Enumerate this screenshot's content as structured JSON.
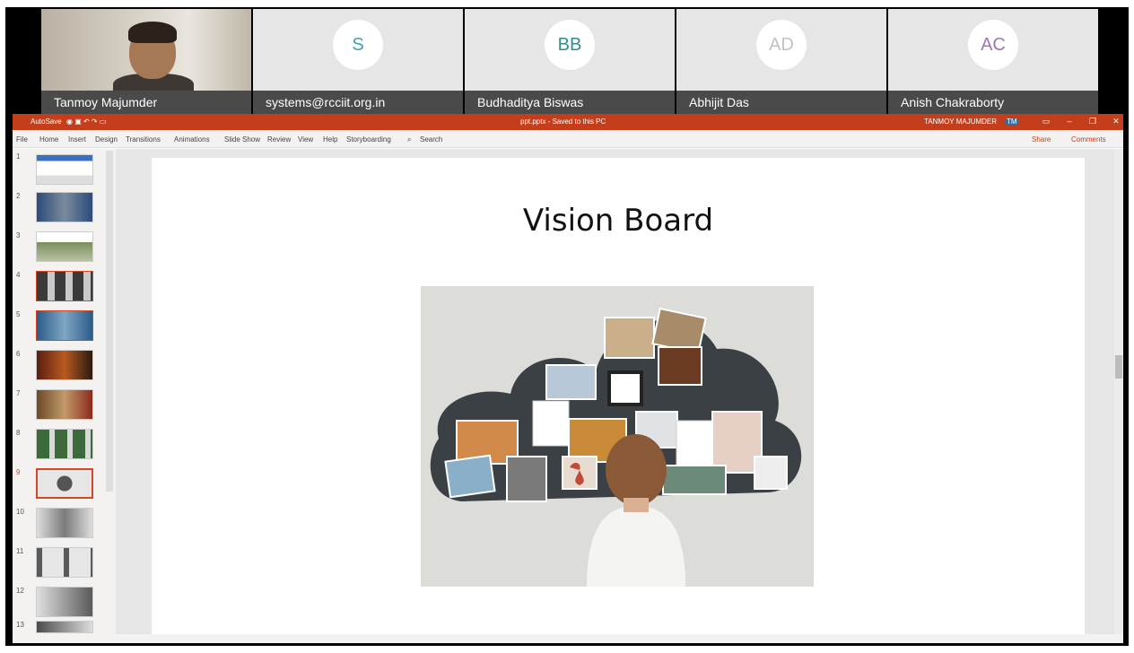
{
  "participants": [
    {
      "name": "Tanmoy Majumder",
      "initials": "",
      "video": true
    },
    {
      "name": "systems@rcciit.org.in",
      "initials": "S",
      "color": "#3aa3b0"
    },
    {
      "name": "Budhaditya Biswas",
      "initials": "BB",
      "color": "#2f8f8a"
    },
    {
      "name": "Abhijit Das",
      "initials": "AD",
      "color": "#c2c2c2"
    },
    {
      "name": "Anish Chakraborty",
      "initials": "AC",
      "color": "#9d75b8"
    }
  ],
  "ppt": {
    "titlebar": {
      "autosave": "AutoSave",
      "doc_title": "ppt.pptx - Saved to this PC",
      "user": "TANMOY MAJUMDER",
      "user_initials": "TM",
      "accent": "#c43e1c"
    },
    "tabs": [
      "File",
      "Home",
      "Insert",
      "Design",
      "Transitions",
      "Animations",
      "Slide Show",
      "Review",
      "View",
      "Help",
      "Storyboarding"
    ],
    "search": "Search",
    "share": "Share",
    "comments": "Comments",
    "slide_numbers": [
      "1",
      "2",
      "3",
      "4",
      "5",
      "6",
      "7",
      "8",
      "9",
      "10",
      "11",
      "12",
      "13"
    ],
    "active_slide": "9",
    "slide": {
      "title": "Vision Board"
    }
  }
}
